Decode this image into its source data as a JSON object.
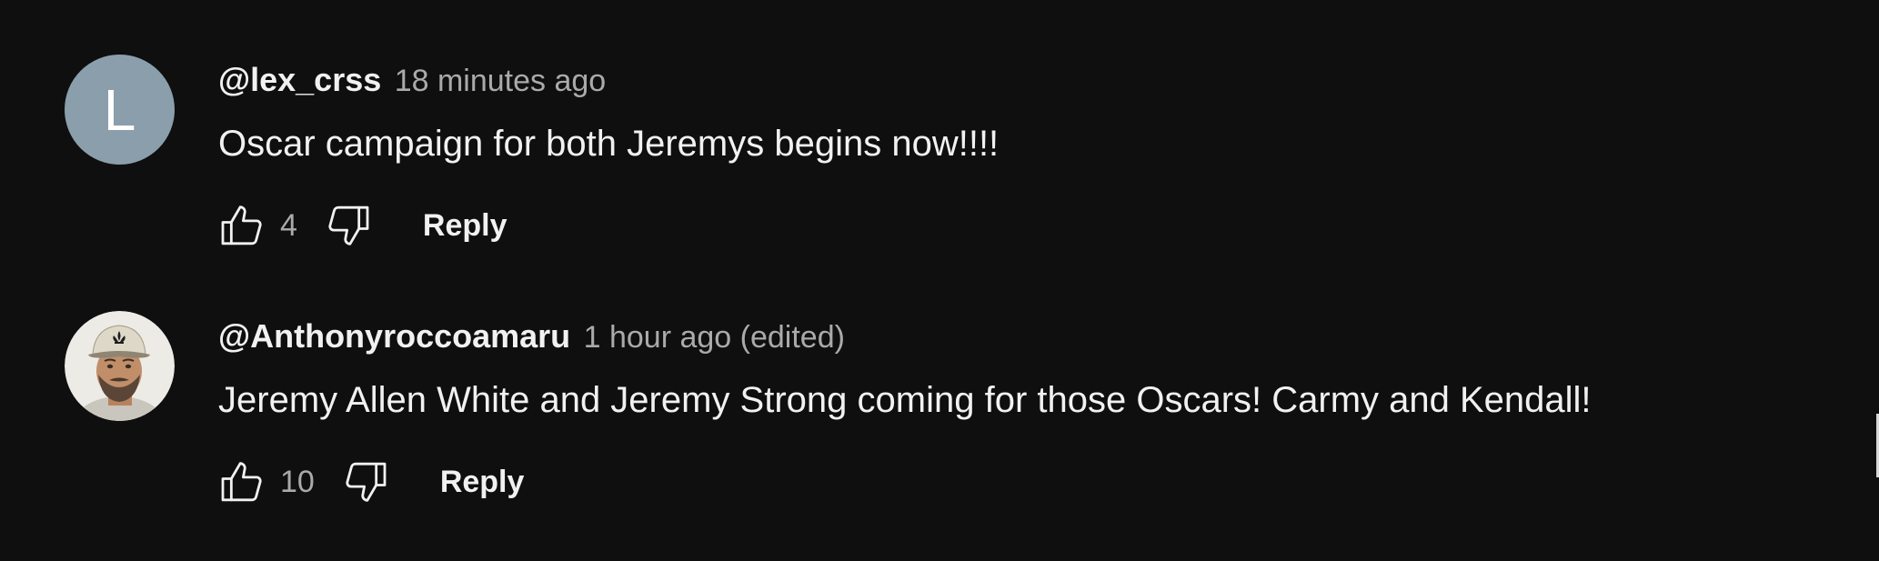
{
  "comments": [
    {
      "avatar_letter": "L",
      "author": "@lex_crss",
      "time": "18 minutes ago",
      "text": "Oscar campaign for both Jeremys begins now!!!!",
      "likes": "4",
      "reply_label": "Reply"
    },
    {
      "author": "@Anthonyroccoamaru",
      "time": "1 hour ago (edited)",
      "text": "Jeremy Allen White and Jeremy Strong coming for those Oscars! Carmy and Kendall!",
      "likes": "10",
      "reply_label": "Reply"
    }
  ],
  "colors": {
    "background": "#0f0f0f",
    "avatar_bg": "#8b9eab",
    "primary_text": "#f1f1f1",
    "secondary_text": "#aaaaaa"
  },
  "icons": {
    "like": "thumbs-up-icon",
    "dislike": "thumbs-down-icon"
  }
}
